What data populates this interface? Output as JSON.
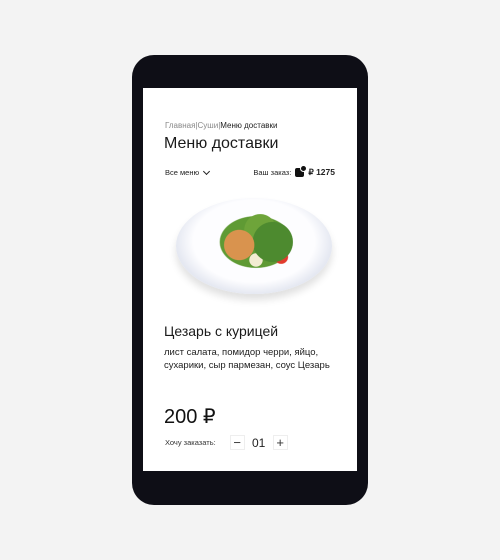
{
  "breadcrumb": {
    "items": [
      "Главная",
      "Суши"
    ],
    "current": "Меню доставки"
  },
  "page_title": "Меню доставки",
  "menu_filter": {
    "label": "Все меню",
    "icon": "chevron-down-icon"
  },
  "order": {
    "label": "Ваш заказ:",
    "icon": "cart-icon",
    "total": "₽ 1275"
  },
  "product": {
    "name": "Цезарь с курицей",
    "description": "лист салата, помидор черри, яйцо, сухарики, сыр пармезан, соус Цезарь",
    "price": "200 ₽"
  },
  "quantity": {
    "label": "Хочу заказать:",
    "value": "01",
    "minus": "−",
    "plus": "+"
  }
}
